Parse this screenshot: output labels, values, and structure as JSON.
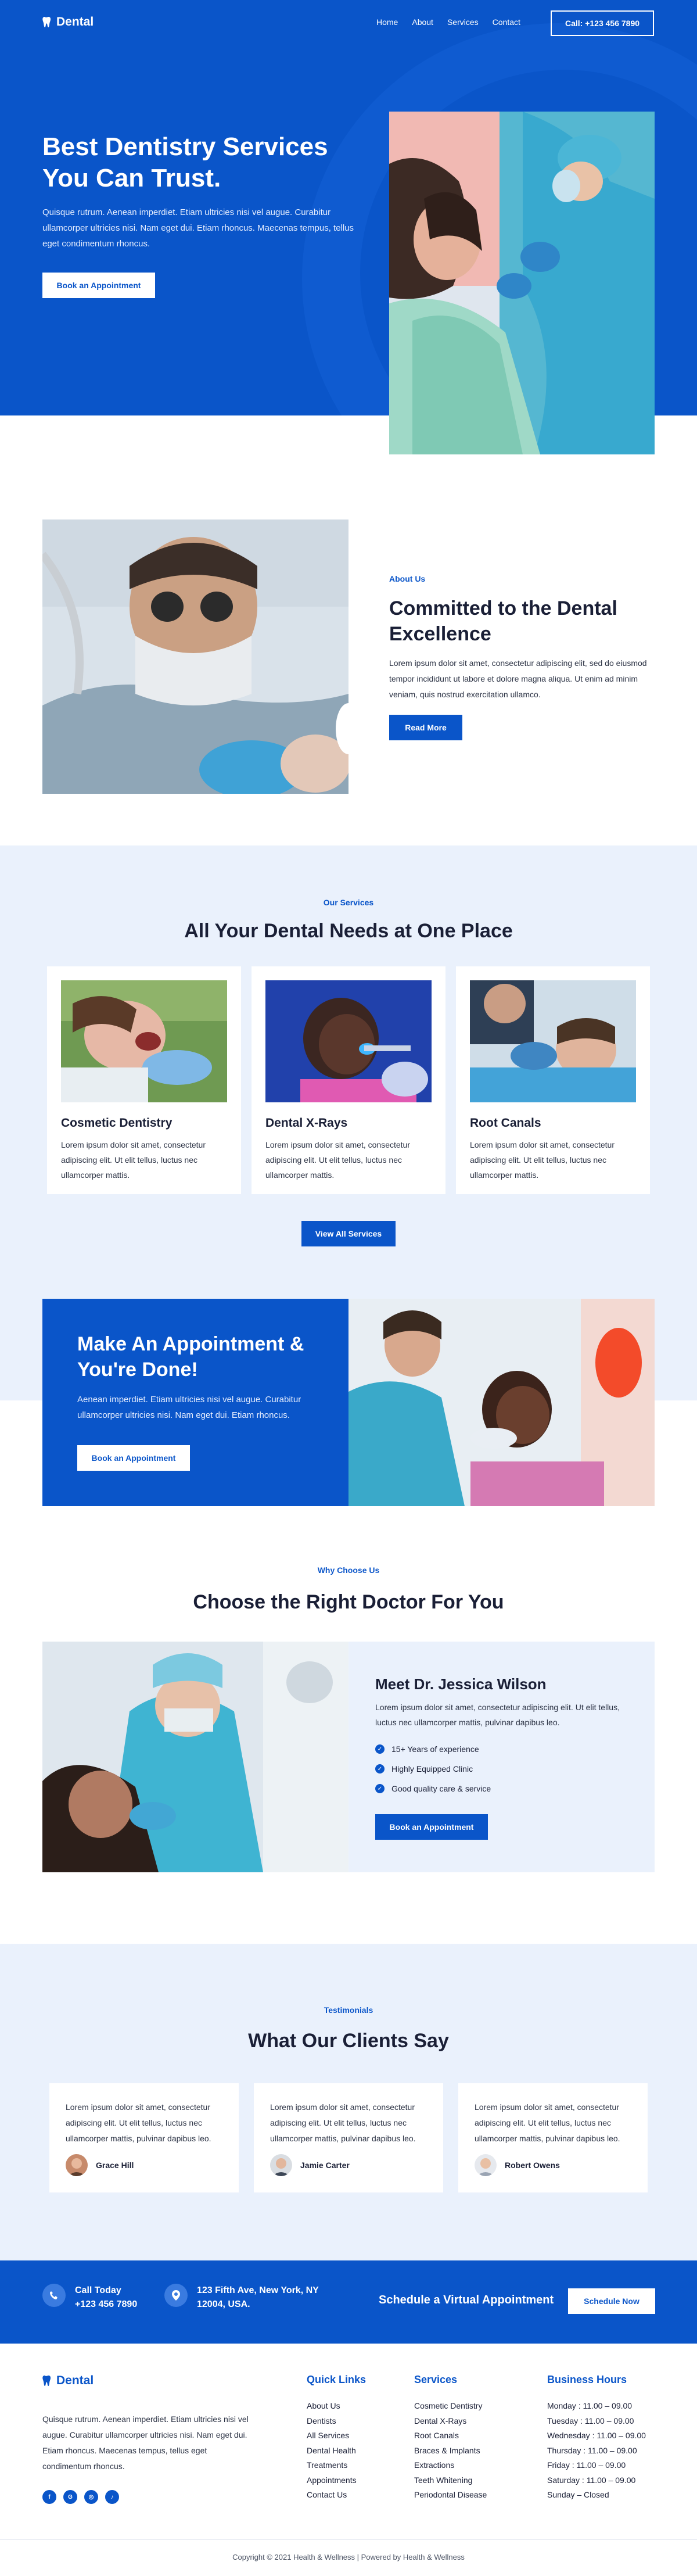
{
  "brand": {
    "name": "Dental",
    "accent": "#0a55c9",
    "light_bg": "#eaf1fc"
  },
  "nav": {
    "items": [
      "Home",
      "About",
      "Services",
      "Contact"
    ],
    "call_label": "Call: +123 456 7890"
  },
  "hero": {
    "title": "Best Dentistry Services You Can Trust.",
    "text": "Quisque rutrum. Aenean imperdiet. Etiam ultricies nisi vel augue. Curabitur ullamcorper ultricies nisi. Nam eget dui. Etiam rhoncus. Maecenas tempus, tellus eget condimentum rhoncus.",
    "button": "Book an Appointment"
  },
  "about": {
    "label": "About Us",
    "title": "Committed to the Dental Excellence",
    "text": "Lorem ipsum dolor sit amet, consectetur adipiscing elit, sed do eiusmod tempor incididunt ut labore et dolore magna aliqua. Ut enim ad minim veniam, quis nostrud exercitation ullamco.",
    "button": "Read More"
  },
  "services": {
    "label": "Our Services",
    "title": "All Your Dental Needs at One Place",
    "cards": [
      {
        "title": "Cosmetic Dentistry",
        "text": "Lorem ipsum dolor sit amet, consectetur adipiscing elit. Ut elit tellus, luctus nec ullamcorper mattis."
      },
      {
        "title": "Dental X-Rays",
        "text": "Lorem ipsum dolor sit amet, consectetur adipiscing elit. Ut elit tellus, luctus nec ullamcorper mattis."
      },
      {
        "title": "Root Canals",
        "text": "Lorem ipsum dolor sit amet, consectetur adipiscing elit. Ut elit tellus, luctus nec ullamcorper mattis."
      }
    ],
    "button": "View All Services"
  },
  "appointment": {
    "title": "Make An Appointment & You're Done!",
    "text": "Aenean imperdiet. Etiam ultricies nisi vel augue. Curabitur ullamcorper ultricies nisi. Nam eget dui. Etiam rhoncus.",
    "button": "Book an Appointment"
  },
  "why": {
    "label": "Why Choose Us",
    "title": "Choose the Right Doctor For You",
    "doctor_title": "Meet Dr. Jessica Wilson",
    "text": "Lorem ipsum dolor sit amet, consectetur adipiscing elit. Ut elit tellus, luctus nec ullamcorper mattis, pulvinar dapibus leo.",
    "points": [
      "15+ Years of experience",
      "Highly Equipped Clinic",
      "Good quality care & service"
    ],
    "button": "Book an Appointment"
  },
  "testimonials": {
    "label": "Testimonials",
    "title": "What Our Clients Say",
    "items": [
      {
        "text": "Lorem ipsum dolor sit amet, consectetur adipiscing elit. Ut elit tellus, luctus nec ullamcorper mattis, pulvinar dapibus leo.",
        "name": "Grace Hill"
      },
      {
        "text": "Lorem ipsum dolor sit amet, consectetur adipiscing elit. Ut elit tellus, luctus nec ullamcorper mattis, pulvinar dapibus leo.",
        "name": "Jamie Carter"
      },
      {
        "text": "Lorem ipsum dolor sit amet, consectetur adipiscing elit. Ut elit tellus, luctus nec ullamcorper mattis, pulvinar dapibus leo.",
        "name": "Robert Owens"
      }
    ]
  },
  "cta": {
    "call_label": "Call Today",
    "call_number": "+123 456 7890",
    "address_line1": "123 Fifth Ave, New York, NY",
    "address_line2": "12004, USA.",
    "title": "Schedule a Virtual Appointment",
    "button": "Schedule Now"
  },
  "footer": {
    "about": "Quisque rutrum. Aenean imperdiet. Etiam ultricies nisi vel augue. Curabitur ullamcorper ultricies nisi. Nam eget dui. Etiam rhoncus. Maecenas tempus, tellus eget condimentum rhoncus.",
    "social": [
      "f",
      "G",
      "◎",
      "♪"
    ],
    "quick_links_title": "Quick Links",
    "quick_links": [
      "About Us",
      "Dentists",
      "All Services",
      "Dental Health",
      "Treatments",
      "Appointments",
      "Contact Us"
    ],
    "services_title": "Services",
    "services": [
      "Cosmetic Dentistry",
      "Dental X-Rays",
      "Root Canals",
      "Braces & Implants",
      "Extractions",
      "Teeth Whitening",
      "Periodontal Disease"
    ],
    "hours_title": "Business Hours",
    "hours": [
      "Monday : 11.00 – 09.00",
      "Tuesday : 11.00 – 09.00",
      "Wednesday : 11.00 – 09.00",
      "Thursday : 11.00 – 09.00",
      "Friday : 11.00 – 09.00",
      "Saturday : 11.00 – 09.00",
      "Sunday – Closed"
    ],
    "copyright": "Copyright © 2021 Health & Wellness | Powered by Health & Wellness"
  }
}
